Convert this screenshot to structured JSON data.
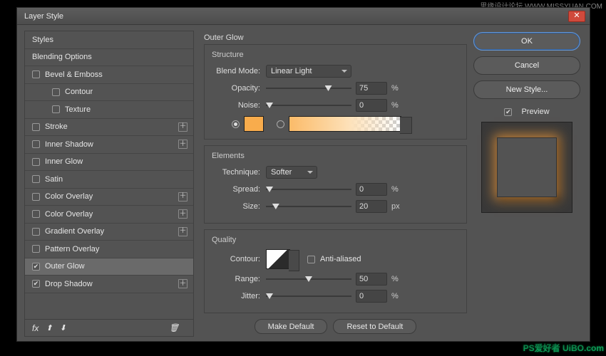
{
  "watermarks": {
    "top": "思缘设计论坛 WWW.MISSYUAN.COM",
    "bottom": "PS爱好者 UiBO.com"
  },
  "dialog": {
    "title": "Layer Style"
  },
  "styles": {
    "items": [
      {
        "label": "Styles",
        "checkbox": false,
        "indent": 0,
        "fx": false
      },
      {
        "label": "Blending Options",
        "checkbox": false,
        "indent": 0,
        "fx": false
      },
      {
        "label": "Bevel & Emboss",
        "checkbox": true,
        "checked": false,
        "indent": 0,
        "fx": false
      },
      {
        "label": "Contour",
        "checkbox": true,
        "checked": false,
        "indent": 1,
        "fx": false
      },
      {
        "label": "Texture",
        "checkbox": true,
        "checked": false,
        "indent": 1,
        "fx": false
      },
      {
        "label": "Stroke",
        "checkbox": true,
        "checked": false,
        "indent": 0,
        "fx": true
      },
      {
        "label": "Inner Shadow",
        "checkbox": true,
        "checked": false,
        "indent": 0,
        "fx": true
      },
      {
        "label": "Inner Glow",
        "checkbox": true,
        "checked": false,
        "indent": 0,
        "fx": false
      },
      {
        "label": "Satin",
        "checkbox": true,
        "checked": false,
        "indent": 0,
        "fx": false
      },
      {
        "label": "Color Overlay",
        "checkbox": true,
        "checked": false,
        "indent": 0,
        "fx": true
      },
      {
        "label": "Color Overlay",
        "checkbox": true,
        "checked": false,
        "indent": 0,
        "fx": true
      },
      {
        "label": "Gradient Overlay",
        "checkbox": true,
        "checked": false,
        "indent": 0,
        "fx": true
      },
      {
        "label": "Pattern Overlay",
        "checkbox": true,
        "checked": false,
        "indent": 0,
        "fx": false
      },
      {
        "label": "Outer Glow",
        "checkbox": true,
        "checked": true,
        "indent": 0,
        "fx": false,
        "selected": true
      },
      {
        "label": "Drop Shadow",
        "checkbox": true,
        "checked": true,
        "indent": 0,
        "fx": true
      }
    ],
    "footer_fx": "fx"
  },
  "panel": {
    "title": "Outer Glow",
    "structure": {
      "legend": "Structure",
      "blend_mode_lbl": "Blend Mode:",
      "blend_mode_val": "Linear Light",
      "opacity_lbl": "Opacity:",
      "opacity_val": "75",
      "opacity_unit": "%",
      "opacity_pct": 75,
      "noise_lbl": "Noise:",
      "noise_val": "0",
      "noise_unit": "%",
      "noise_pct": 0,
      "color": "#f8ac4c"
    },
    "elements": {
      "legend": "Elements",
      "technique_lbl": "Technique:",
      "technique_val": "Softer",
      "spread_lbl": "Spread:",
      "spread_val": "0",
      "spread_unit": "%",
      "spread_pct": 0,
      "size_lbl": "Size:",
      "size_val": "20",
      "size_unit": "px",
      "size_pct": 8
    },
    "quality": {
      "legend": "Quality",
      "contour_lbl": "Contour:",
      "aa_lbl": "Anti-aliased",
      "range_lbl": "Range:",
      "range_val": "50",
      "range_unit": "%",
      "range_pct": 50,
      "jitter_lbl": "Jitter:",
      "jitter_val": "0",
      "jitter_unit": "%",
      "jitter_pct": 0
    },
    "make_default": "Make Default",
    "reset_default": "Reset to Default"
  },
  "right": {
    "ok": "OK",
    "cancel": "Cancel",
    "new_style": "New Style...",
    "preview": "Preview"
  }
}
